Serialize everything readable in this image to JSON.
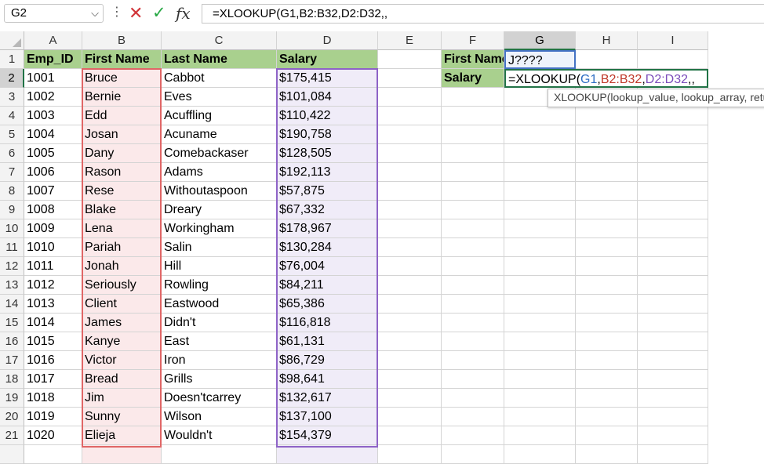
{
  "formula_bar": {
    "name_box": "G2",
    "formula": "=XLOOKUP(G1,B2:B32,D2:D32,,",
    "cancel_icon": "x-icon",
    "enter_icon": "check-icon",
    "function_label": "fx"
  },
  "columns": [
    "A",
    "B",
    "C",
    "D",
    "E",
    "F",
    "G",
    "H",
    "I"
  ],
  "selected_column": "G",
  "selected_row": "2",
  "headers": {
    "a": "Emp_ID",
    "b": "First Name",
    "c": "Last Name",
    "d": "Salary"
  },
  "rows": [
    [
      "1001",
      "Bruce",
      "Cabbot",
      "$175,415"
    ],
    [
      "1002",
      "Bernie",
      "Eves",
      "$101,084"
    ],
    [
      "1003",
      "Edd",
      "Acuffling",
      "$110,422"
    ],
    [
      "1004",
      "Josan",
      "Acuname",
      "$190,758"
    ],
    [
      "1005",
      "Dany",
      "Comebackaser",
      "$128,505"
    ],
    [
      "1006",
      "Rason",
      "Adams",
      "$192,113"
    ],
    [
      "1007",
      "Rese",
      "Withoutaspoon",
      "$57,875"
    ],
    [
      "1008",
      "Blake",
      "Dreary",
      "$67,332"
    ],
    [
      "1009",
      "Lena",
      "Workingham",
      "$178,967"
    ],
    [
      "1010",
      "Pariah",
      "Salin",
      "$130,284"
    ],
    [
      "1011",
      "Jonah",
      "Hill",
      "$76,004"
    ],
    [
      "1012",
      "Seriously",
      "Rowling",
      "$84,211"
    ],
    [
      "1013",
      "Client",
      "Eastwood",
      "$65,386"
    ],
    [
      "1014",
      "James",
      "Didn't",
      "$116,818"
    ],
    [
      "1015",
      "Kanye",
      "East",
      "$61,131"
    ],
    [
      "1016",
      "Victor",
      "Iron",
      "$86,729"
    ],
    [
      "1017",
      "Bread",
      "Grills",
      "$98,641"
    ],
    [
      "1018",
      "Jim",
      "Doesn'tcarrey",
      "$132,617"
    ],
    [
      "1019",
      "Sunny",
      "Wilson",
      "$137,100"
    ],
    [
      "1020",
      "Elieja",
      "Wouldn't",
      "$154,379"
    ]
  ],
  "lookup": {
    "f1_label": "First Name",
    "g1_value": "J????",
    "f2_label": "Salary",
    "g2_edit": {
      "prefix": "=XLOOKUP(",
      "ref1": "G1",
      "sep1": ",",
      "ref2": "B2:B32",
      "sep2": ",",
      "ref3": "D2:D32",
      "suffix": ",,"
    }
  },
  "tooltip": "XLOOKUP(lookup_value, lookup_array, return_array, [if_not_found], [match_mode], [search_mode])",
  "colors": {
    "header_green": "#a9d08e",
    "range_red": "#e06666",
    "range_purple": "#8e63c7",
    "ref_blue": "#4472c4",
    "selection_green": "#217346"
  }
}
